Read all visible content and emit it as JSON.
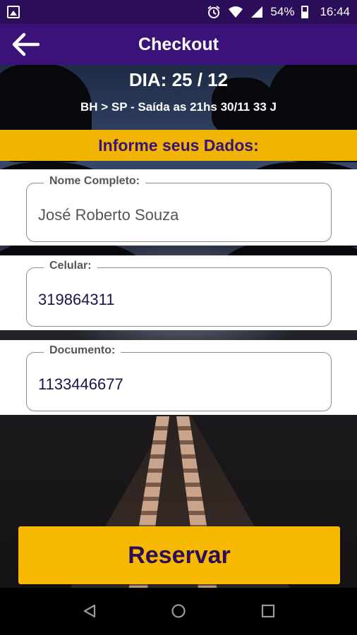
{
  "status_bar": {
    "battery": "54%",
    "time": "16:44",
    "icons": [
      "image-icon",
      "alarm-icon",
      "wifi-icon",
      "signal-icon",
      "battery-icon"
    ]
  },
  "app_bar": {
    "title": "Checkout",
    "back_icon": "arrow-left-icon"
  },
  "trip": {
    "day": "DIA: 25 / 12",
    "route": "BH > SP - Saída as 21hs 30/11 33 J"
  },
  "form": {
    "heading": "Informe seus Dados:",
    "fields": [
      {
        "label": "Nome Completo:",
        "value": "José Roberto Souza"
      },
      {
        "label": "Celular:",
        "value": "319864311"
      },
      {
        "label": "Documento:",
        "value": "1133446677"
      }
    ]
  },
  "reserve_button": {
    "label": "Reservar"
  },
  "nav_bar": {
    "icons": [
      "back-triangle-icon",
      "home-circle-icon",
      "recents-square-icon"
    ]
  },
  "colors": {
    "status_bar": "#2c0d5a",
    "app_bar": "#3a127a",
    "accent_yellow": "#f0b400",
    "heading_purple": "#3a127a"
  }
}
